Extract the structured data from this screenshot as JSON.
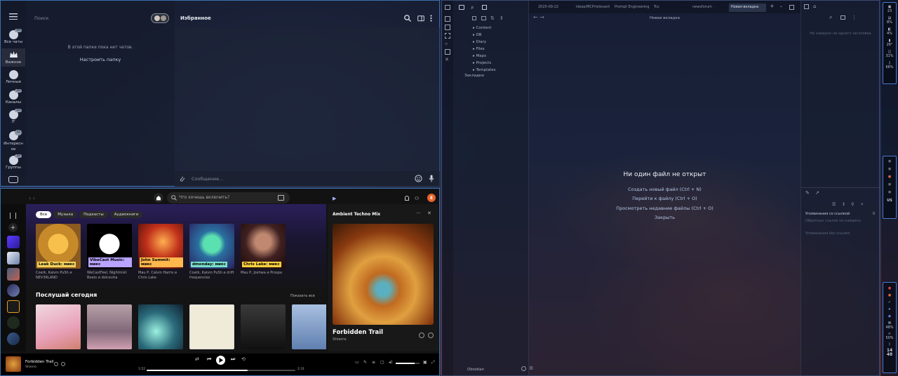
{
  "telegram": {
    "search_placeholder": "Поиск",
    "chat_title": "Избранное",
    "empty_text": "В этой папке пока нет чатов.",
    "setup_link": "Настроить папку",
    "composer_placeholder": "Сообщение...",
    "folders": [
      {
        "label": "Все чаты",
        "badge": "99"
      },
      {
        "label": "Важное",
        "badge": ""
      },
      {
        "label": "Личные",
        "badge": ""
      },
      {
        "label": "Каналы",
        "badge": "20"
      },
      {
        "label": "IT",
        "badge": "10"
      },
      {
        "label": "Интересн ое",
        "badge": "32"
      },
      {
        "label": "Группы",
        "badge": "32"
      }
    ]
  },
  "spotify": {
    "search_placeholder": "Что хочешь включить?",
    "avatar_letter": "E",
    "chips": [
      "Все",
      "Музыка",
      "Подкасты",
      "Аудиокниги"
    ],
    "mixes": [
      {
        "tag": "Leak Duck: микс",
        "tag_color": "#f4d35e",
        "caption": "Coatk, Kalvin PuSh и NEV3RLAND"
      },
      {
        "tag": "VibeCast Music: микс",
        "tag_color": "#b9a4ff",
        "caption": "WeCastFeel, Nightmist Beats и dolcevita"
      },
      {
        "tag": "John Summit: микс",
        "tag_color": "#ffb84d",
        "caption": "Mau P, Calvin Harris и Chris Lake"
      },
      {
        "tag": "dmonday: микс",
        "tag_color": "#7be0c9",
        "caption": "Coatk, Kalvin PuSh и drift frequencies"
      },
      {
        "tag": "Chris Lake: микс",
        "tag_color": "#ffd23f",
        "caption": "Mau P, Joshwa и Prospa"
      }
    ],
    "section_title": "Послушай сегодня",
    "show_all": "Показать все",
    "panel_title": "Ambient Techno Mix",
    "track_title": "Forbidden Trail",
    "track_artist": "Shierro",
    "time_current": "1:52",
    "time_total": "2:31",
    "progress": 0.68,
    "volume": 0.8
  },
  "obsidian": {
    "tabs": [
      "2025-09-22",
      "Ideas/MCP/relevant",
      "Prompt Engineering",
      "Tcs",
      "newsforum",
      "Новая вкладка"
    ],
    "active_tab": "Новая вкладка",
    "tree": [
      "Content",
      "DB",
      "Diary",
      "Files",
      "Maps",
      "Projects",
      "Templates"
    ],
    "bookmarks": "Закладки",
    "empty_title": "Ни один файл не открыт",
    "actions": [
      "Создать новый файл (Ctrl + N)",
      "Перейти к файлу (Ctrl + O)",
      "Просмотреть недавние файлы (Ctrl + O)",
      "Закрыть"
    ],
    "right_top_hint": "Не найдено ни одного заголовка",
    "backlinks_title": "Упоминания со ссылкой",
    "backlinks_count": "0",
    "backlinks_hint": "Обратных ссылок не найдено.",
    "unlinked_title": "Упоминания без ссылки",
    "vault_name": "Obsidian"
  },
  "system": {
    "stats": [
      "23",
      "8%",
      "4%",
      "26°",
      "31%",
      "66%"
    ],
    "lang": "US",
    "cpu": "48%",
    "vol": "50%",
    "clock_h": "14",
    "clock_m": "48"
  }
}
